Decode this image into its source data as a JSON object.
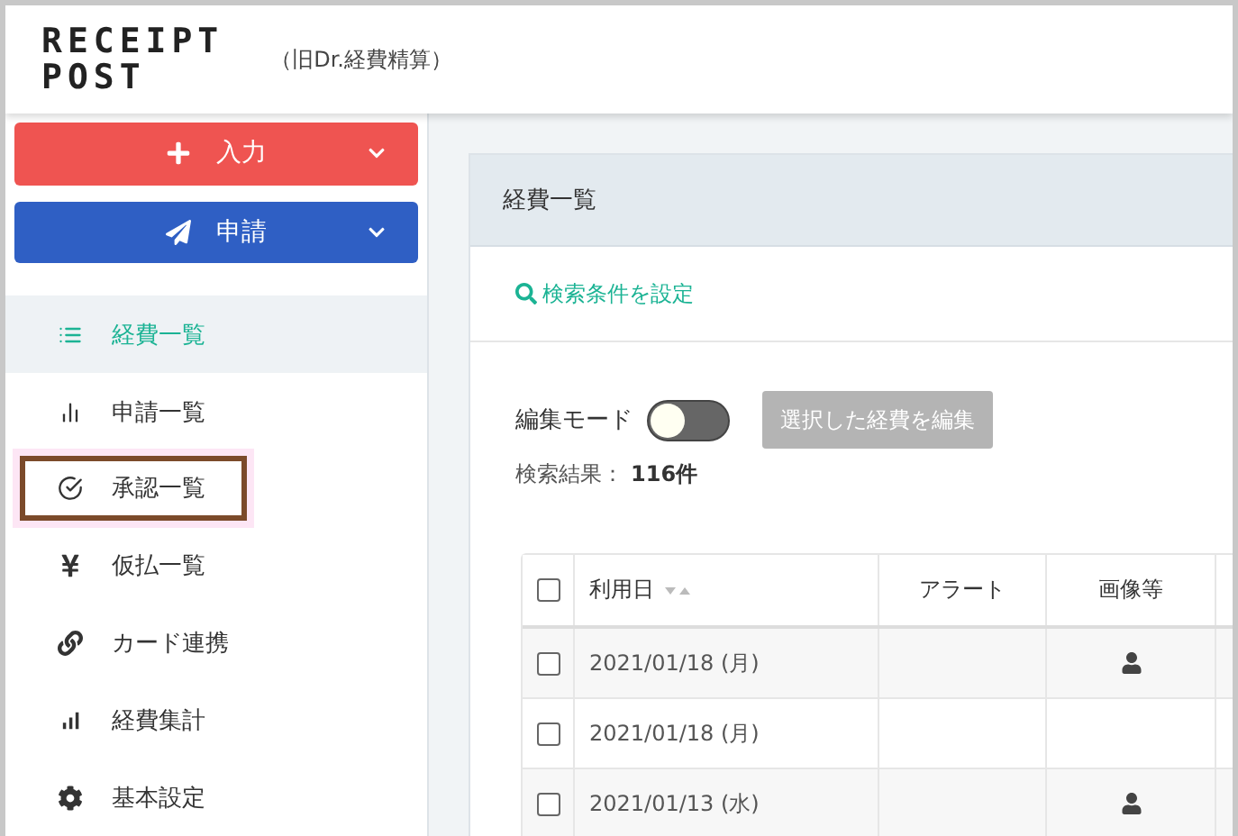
{
  "header": {
    "logo_lines": [
      "RECEIPT",
      "POST"
    ],
    "subtitle": "（旧Dr.経費精算）"
  },
  "action_buttons": [
    {
      "kind": "input",
      "label": "入力"
    },
    {
      "kind": "apply",
      "label": "申請"
    }
  ],
  "sidebar": {
    "items": [
      {
        "kind": "list",
        "label": "経費一覧",
        "selected": true,
        "highlighted": false
      },
      {
        "kind": "chart",
        "label": "申請一覧",
        "selected": false,
        "highlighted": false
      },
      {
        "kind": "check",
        "label": "承認一覧",
        "selected": false,
        "highlighted": true
      },
      {
        "kind": "yen",
        "label": "仮払一覧",
        "selected": false,
        "highlighted": false
      },
      {
        "kind": "link",
        "label": "カード連携",
        "selected": false,
        "highlighted": false
      },
      {
        "kind": "signal",
        "label": "経費集計",
        "selected": false,
        "highlighted": false
      },
      {
        "kind": "gear",
        "label": "基本設定",
        "selected": false,
        "highlighted": false
      }
    ]
  },
  "card": {
    "title": "経費一覧",
    "search_link": "検索条件を設定",
    "edit_mode": {
      "label": "編集モード",
      "on": false
    },
    "edit_button": {
      "label": "選択した経費を編集",
      "disabled": true
    },
    "result_label": "検索結果：",
    "result_count": "116件"
  },
  "table": {
    "columns": [
      "利用日",
      "アラート",
      "画像等"
    ],
    "all_checked": false,
    "rows": [
      {
        "date": "2021/01/18 (月)",
        "checked": false,
        "has_image": true
      },
      {
        "date": "2021/01/18 (月)",
        "checked": false,
        "has_image": false
      },
      {
        "date": "2021/01/13 (水)",
        "checked": false,
        "has_image": true
      }
    ]
  }
}
